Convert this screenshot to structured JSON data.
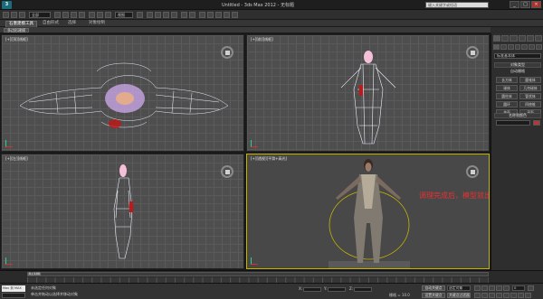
{
  "titlebar": {
    "app_title": "Untitled - 3ds Max 2012 - 无标题",
    "search_placeholder": "键入关键字或短语",
    "logo": "3",
    "min": "_",
    "max": "□",
    "close": "×"
  },
  "toolbar": {
    "selection_filter": "全部",
    "view_dropdown": "视图",
    "ribbon_tabs": [
      "石墨建模工具",
      "自由形式",
      "选择",
      "对象绘制"
    ],
    "ribbon_sub": "多边形建模"
  },
  "viewports": {
    "top_left": "[+][顶][线框]",
    "top_right": "[+][前][线框]",
    "bottom_left": "[+][左][线框]",
    "bottom_right": "[+][透视][平滑+高光]",
    "annotation": "调理完成后，模型就出来啦"
  },
  "command_panel": {
    "dropdown": "标准基本体",
    "object_type_header": "对象类型",
    "autogrid": "自动栅格",
    "buttons": [
      "长方体",
      "圆锥体",
      "球体",
      "几何球体",
      "圆柱体",
      "管状体",
      "圆环",
      "四棱锥",
      "茶壶",
      "平面"
    ],
    "name_color_header": "名称和颜色"
  },
  "timeline": {
    "position": "0 / 100",
    "ticks": [
      "0",
      "10",
      "20",
      "30",
      "40",
      "50",
      "60",
      "70",
      "80",
      "90",
      "100"
    ]
  },
  "statusbar": {
    "listener": "Max 到 MAX",
    "status_line1": "未选定任何对象",
    "status_line2": "单击并拖动以选择并移动对象",
    "x_label": "X:",
    "y_label": "Y:",
    "z_label": "Z:",
    "grid": "栅格 = 10.0",
    "auto_key": "自动关键点",
    "set_key": "设置关键点",
    "key_filter": "选定对象",
    "key_filters_btn": "关键点过滤器",
    "add_time_tag": "添加时间标记",
    "frame": "0"
  }
}
